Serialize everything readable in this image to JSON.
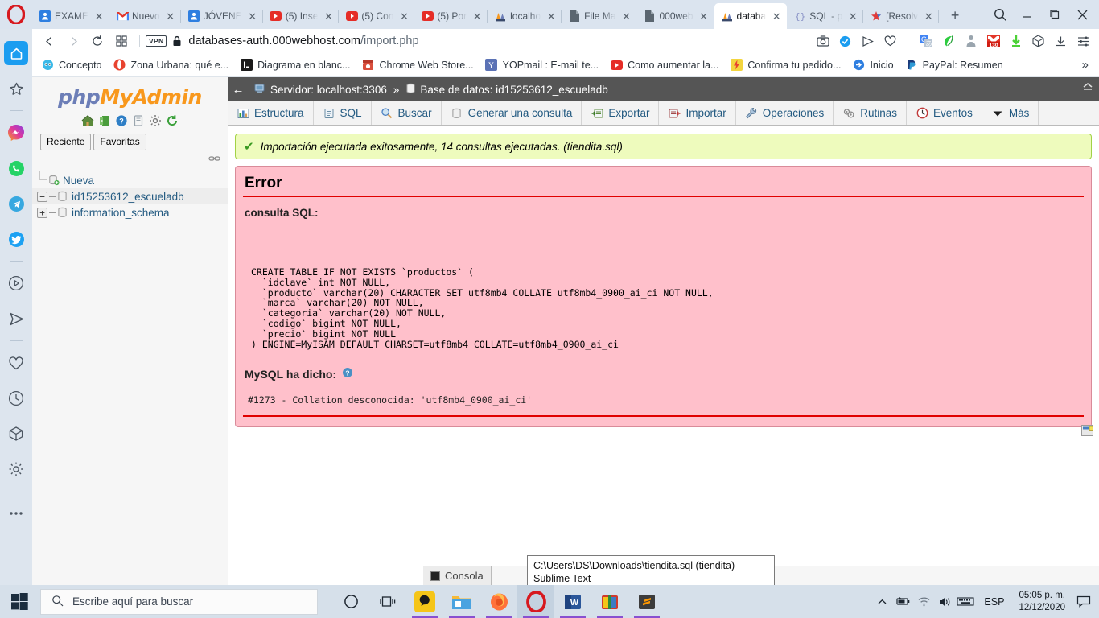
{
  "browser": {
    "name": "Opera",
    "tabs": [
      {
        "title": "EXAME",
        "icon": "contacts-icon",
        "active": false
      },
      {
        "title": "Nuevo",
        "icon": "gmail-icon",
        "active": false
      },
      {
        "title": "JÓVENE",
        "icon": "contacts-icon",
        "active": false
      },
      {
        "title": "(5) Inse",
        "icon": "youtube-icon",
        "active": false
      },
      {
        "title": "(5) Con",
        "icon": "youtube-icon",
        "active": false
      },
      {
        "title": "(5) Por",
        "icon": "youtube-icon",
        "active": false
      },
      {
        "title": "localho",
        "icon": "phpmyadmin-icon",
        "active": false
      },
      {
        "title": "File Ma",
        "icon": "page-icon",
        "active": false
      },
      {
        "title": "000web",
        "icon": "page-icon",
        "active": false
      },
      {
        "title": "databa",
        "icon": "phpmyadmin-icon",
        "active": true
      },
      {
        "title": "SQL - p",
        "icon": "code-icon",
        "active": false
      },
      {
        "title": "[Resolv",
        "icon": "star-colored-icon",
        "active": false
      }
    ],
    "new_tab_label": "+",
    "window_controls": {
      "search": "search-icon",
      "minimize": "_",
      "maximize": "maximize-icon",
      "close": "close-icon"
    },
    "address": {
      "url_host": "databases-auth.000webhost.com",
      "url_path": "/import.php",
      "vpn_label": "VPN",
      "lock": "lock-icon",
      "back": "back-arrow-icon",
      "forward": "forward-arrow-icon",
      "reload": "reload-icon",
      "tiles": "tiles-icon"
    },
    "address_icons": [
      "snapshot-icon",
      "shield-check-icon",
      "send-icon",
      "heart-icon",
      "gtranslate-icon",
      "leaf-icon",
      "person-icon",
      "gmail-badge-icon",
      "download-green-icon",
      "cube-icon",
      "download-icon",
      "menu-icon"
    ],
    "gmail_badge_count": "130",
    "bookmarks": [
      {
        "label": "Concepto",
        "icon": "smiley-icon"
      },
      {
        "label": "Zona Urbana: qué e...",
        "icon": "opera-red-icon"
      },
      {
        "label": "Diagrama en blanc...",
        "icon": "lucid-icon"
      },
      {
        "label": "Chrome Web Store...",
        "icon": "chrome-store-icon"
      },
      {
        "label": "YOPmail : E-mail te...",
        "icon": "yopmail-icon"
      },
      {
        "label": "Como aumentar la...",
        "icon": "youtube-icon"
      },
      {
        "label": "Confirma tu pedido...",
        "icon": "flash-icon"
      },
      {
        "label": "Inicio",
        "icon": "arrow-circle-icon"
      },
      {
        "label": "PayPal: Resumen",
        "icon": "paypal-icon"
      }
    ],
    "bookmarks_overflow": "»",
    "sidebar_icons": [
      "home-icon",
      "favorites-star-icon",
      "divider",
      "messenger-icon",
      "whatsapp-icon",
      "telegram-icon",
      "twitter-icon",
      "divider",
      "player-icon",
      "send-plane-icon",
      "divider",
      "heart-icon",
      "history-clock-icon",
      "cube-icon",
      "settings-gear-icon",
      "divider-full",
      "more-dots-icon"
    ]
  },
  "pma": {
    "logo": {
      "php": "php",
      "my": "My",
      "admin": "Admin"
    },
    "header_icons": [
      "home-icon",
      "logout-icon",
      "help-icon",
      "docs-icon",
      "settings-icon",
      "refresh-icon"
    ],
    "tabs": [
      {
        "label": "Reciente"
      },
      {
        "label": "Favoritas"
      }
    ],
    "tree": [
      {
        "label": "Nueva",
        "toggle": "",
        "icon": "new-db-icon",
        "selected": false
      },
      {
        "label": "id15253612_escueladb",
        "toggle": "−",
        "icon": "db-icon",
        "selected": true
      },
      {
        "label": "information_schema",
        "toggle": "+",
        "icon": "db-icon",
        "selected": false
      }
    ],
    "breadcrumb": {
      "back": "←",
      "server_icon": "server-icon",
      "server": "Servidor: localhost:3306",
      "separator": "»",
      "db_icon": "database-icon",
      "database": "Base de datos: id15253612_escueladb",
      "collapse": "collapse-icon"
    },
    "nav": [
      {
        "label": "Estructura",
        "icon": "structure-icon"
      },
      {
        "label": "SQL",
        "icon": "sql-icon"
      },
      {
        "label": "Buscar",
        "icon": "search-icon"
      },
      {
        "label": "Generar una consulta",
        "icon": "query-icon"
      },
      {
        "label": "Exportar",
        "icon": "export-icon"
      },
      {
        "label": "Importar",
        "icon": "import-icon"
      },
      {
        "label": "Operaciones",
        "icon": "wrench-icon"
      },
      {
        "label": "Rutinas",
        "icon": "routines-icon"
      },
      {
        "label": "Eventos",
        "icon": "events-clock-icon"
      },
      {
        "label": "Más",
        "icon": "chevron-down-icon"
      }
    ],
    "success_message": "Importación ejecutada exitosamente, 14 consultas ejecutadas. (tiendita.sql)",
    "success_icon": "check-icon",
    "error": {
      "title": "Error",
      "query_label": "consulta SQL:",
      "sql": "CREATE TABLE IF NOT EXISTS `productos` (\n  `idclave` int NOT NULL,\n  `producto` varchar(20) CHARACTER SET utf8mb4 COLLATE utf8mb4_0900_ai_ci NOT NULL,\n  `marca` varchar(20) NOT NULL,\n  `categoria` varchar(20) NOT NULL,\n  `codigo` bigint NOT NULL,\n  `precio` bigint NOT NULL\n) ENGINE=MyISAM DEFAULT CHARSET=utf8mb4 COLLATE=utf8mb4_0900_ai_ci",
      "said_label": "MySQL ha dicho:",
      "help_icon": "help-circle-icon",
      "message": "#1273 - Collation desconocida: 'utf8mb4_0900_ai_ci'"
    },
    "console_label": "Consola",
    "console_icon": "console-icon",
    "panel_icon": "window-panel-icon"
  },
  "taskbar": {
    "start_icon": "windows-start-icon",
    "search_placeholder": "Escribe aquí para buscar",
    "search_icon": "search-icon",
    "apps": [
      {
        "name": "cortana-icon",
        "open": false,
        "active": false
      },
      {
        "name": "task-view-icon",
        "open": false,
        "active": false
      },
      {
        "name": "app-yellow-icon",
        "open": true,
        "active": false
      },
      {
        "name": "file-explorer-icon",
        "open": true,
        "active": false
      },
      {
        "name": "firefox-icon",
        "open": true,
        "active": false
      },
      {
        "name": "opera-icon",
        "open": true,
        "active": true
      },
      {
        "name": "word-icon",
        "open": true,
        "active": false
      },
      {
        "name": "winrar-icon",
        "open": true,
        "active": false
      },
      {
        "name": "sublime-text-icon",
        "open": true,
        "active": false
      }
    ],
    "tray": {
      "chevron": "chevron-up-icon",
      "battery": "battery-icon",
      "wifi": "wifi-icon",
      "volume": "volume-icon",
      "keyboard": "keyboard-icon",
      "language": "ESP",
      "time": "05:05 p. m.",
      "date": "12/12/2020",
      "notifications": "notification-icon"
    },
    "tooltip": "C:\\Users\\DS\\Downloads\\tiendita.sql (tiendita) - Sublime Text"
  },
  "colors": {
    "opera_red": "#d7191f",
    "accent_blue": "#1b9df0",
    "error_bg": "#ffc0cb",
    "error_rule": "#e00000",
    "success_bg": "#eefbbd",
    "success_border": "#a2d246",
    "pma_orange": "#f8981d",
    "pma_blue": "#6c7eb7",
    "link_blue": "#235a81"
  }
}
